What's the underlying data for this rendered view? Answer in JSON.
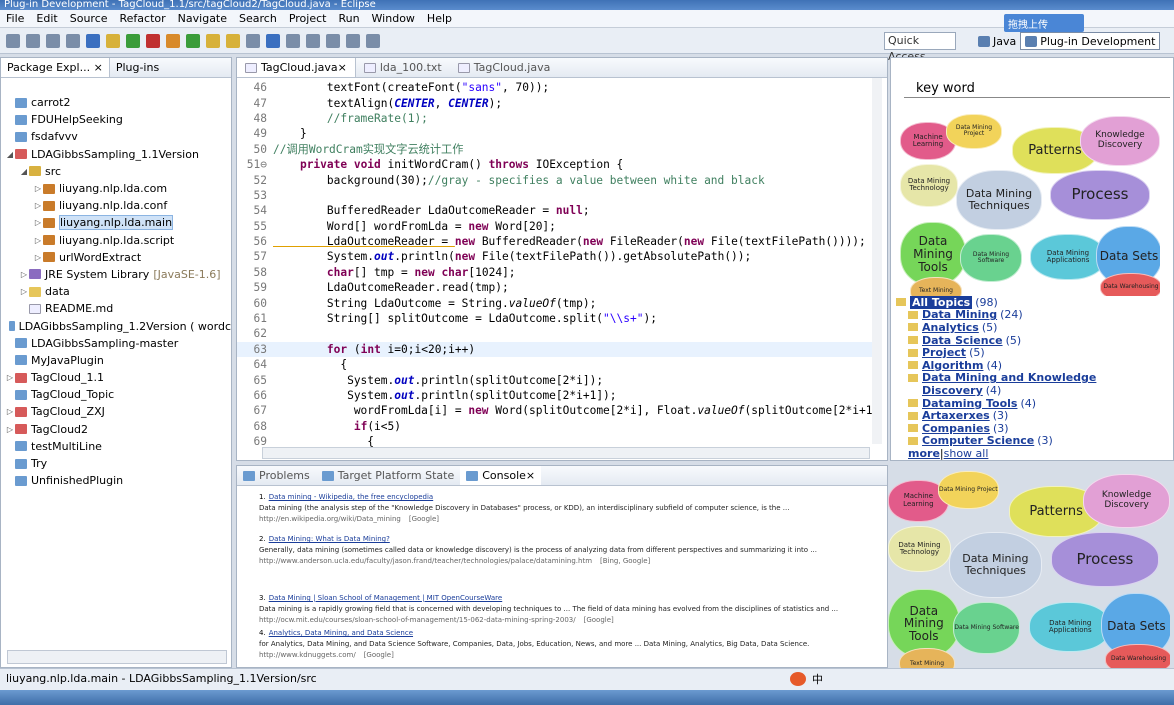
{
  "window": {
    "title": "Plug-in Development - TagCloud_1.1/src/tagCloud2/TagCloud.java - Eclipse"
  },
  "menu": [
    "File",
    "Edit",
    "Source",
    "Refactor",
    "Navigate",
    "Search",
    "Project",
    "Run",
    "Window",
    "Help"
  ],
  "toolbar": {
    "quick_access": "Quick Access",
    "upload_label": "拖拽上传"
  },
  "perspectives": [
    {
      "label": "Java"
    },
    {
      "label": "Plug-in Development"
    }
  ],
  "left_panel": {
    "tabs": [
      "Package Expl...",
      "Plug-ins"
    ],
    "tree": [
      {
        "label": "carrot2",
        "indent": 0,
        "icon": "i-proj",
        "arrow": ""
      },
      {
        "label": "FDUHelpSeeking",
        "indent": 0,
        "icon": "i-proj",
        "arrow": ""
      },
      {
        "label": "fsdafvvv",
        "indent": 0,
        "icon": "i-proj",
        "arrow": ""
      },
      {
        "label": "LDAGibbsSampling_1.1Version",
        "indent": 0,
        "icon": "i-plug",
        "arrow": "◢"
      },
      {
        "label": "src",
        "indent": 1,
        "icon": "i-src",
        "arrow": "◢"
      },
      {
        "label": "liuyang.nlp.lda.com",
        "indent": 2,
        "icon": "i-pkg",
        "arrow": "▷"
      },
      {
        "label": "liuyang.nlp.lda.conf",
        "indent": 2,
        "icon": "i-pkg",
        "arrow": "▷"
      },
      {
        "label": "liuyang.nlp.lda.main",
        "indent": 2,
        "icon": "i-pkg",
        "arrow": "▷",
        "selected": true
      },
      {
        "label": "liuyang.nlp.lda.script",
        "indent": 2,
        "icon": "i-pkg",
        "arrow": "▷"
      },
      {
        "label": "urlWordExtract",
        "indent": 2,
        "icon": "i-pkg",
        "arrow": "▷"
      },
      {
        "label": "JRE System Library",
        "extra": "[JavaSE-1.6]",
        "indent": 1,
        "icon": "i-jre",
        "arrow": "▷"
      },
      {
        "label": "data",
        "indent": 1,
        "icon": "i-fold",
        "arrow": "▷"
      },
      {
        "label": "README.md",
        "indent": 1,
        "icon": "i-file",
        "arrow": ""
      },
      {
        "label": "LDAGibbsSampling_1.2Version ( wordc",
        "indent": 0,
        "icon": "i-proj",
        "arrow": ""
      },
      {
        "label": "LDAGibbsSampling-master",
        "indent": 0,
        "icon": "i-proj",
        "arrow": ""
      },
      {
        "label": "MyJavaPlugin",
        "indent": 0,
        "icon": "i-proj",
        "arrow": ""
      },
      {
        "label": "TagCloud_1.1",
        "indent": 0,
        "icon": "i-plug",
        "arrow": "▷"
      },
      {
        "label": "TagCloud_Topic",
        "indent": 0,
        "icon": "i-proj",
        "arrow": ""
      },
      {
        "label": "TagCloud_ZXJ",
        "indent": 0,
        "icon": "i-plug",
        "arrow": "▷"
      },
      {
        "label": "TagCloud2",
        "indent": 0,
        "icon": "i-plug",
        "arrow": "▷"
      },
      {
        "label": "testMultiLine",
        "indent": 0,
        "icon": "i-proj",
        "arrow": ""
      },
      {
        "label": "Try",
        "indent": 0,
        "icon": "i-proj",
        "arrow": ""
      },
      {
        "label": "UnfinishedPlugin",
        "indent": 0,
        "icon": "i-proj",
        "arrow": ""
      }
    ]
  },
  "editor": {
    "tabs": [
      {
        "label": "TagCloud.java",
        "active": true
      },
      {
        "label": "lda_100.txt"
      },
      {
        "label": "TagCloud.java"
      }
    ],
    "lines": [
      {
        "n": "46",
        "segs": [
          [
            "        textFont(createFont(",
            ""
          ],
          [
            "\"sans\"",
            "str"
          ],
          [
            ", 70));",
            ""
          ]
        ]
      },
      {
        "n": "47",
        "segs": [
          [
            "        textAlign(",
            ""
          ],
          [
            "CENTER",
            "st"
          ],
          [
            ", ",
            ""
          ],
          [
            "CENTER",
            "st"
          ],
          [
            ");",
            ""
          ]
        ]
      },
      {
        "n": "48",
        "segs": [
          [
            "        //frameRate(1);",
            "cm"
          ]
        ]
      },
      {
        "n": "49",
        "segs": [
          [
            "    }",
            ""
          ]
        ]
      },
      {
        "n": "50",
        "segs": [
          [
            "//调用WordCram实现文字云统计工作",
            "cm"
          ]
        ]
      },
      {
        "n": "51⊖",
        "segs": [
          [
            "    ",
            ""
          ],
          [
            "private void",
            "kw"
          ],
          [
            " initWordCram() ",
            ""
          ],
          [
            "throws",
            "kw"
          ],
          [
            " IOException {",
            ""
          ]
        ]
      },
      {
        "n": "52",
        "segs": [
          [
            "        background(30);",
            ""
          ],
          [
            "//gray - specifies a value between white and black",
            "cm"
          ]
        ]
      },
      {
        "n": "53",
        "segs": [
          [
            "",
            ""
          ]
        ]
      },
      {
        "n": "54",
        "segs": [
          [
            "        BufferedReader LdaOutcomeReader = ",
            ""
          ],
          [
            "null",
            "kw"
          ],
          [
            ";",
            ""
          ]
        ]
      },
      {
        "n": "55",
        "segs": [
          [
            "        Word[] wordFromLda = ",
            ""
          ],
          [
            "new",
            "kw"
          ],
          [
            " Word[20];",
            ""
          ]
        ]
      },
      {
        "n": "56",
        "segs": [
          [
            "        LdaOutcomeReader = ",
            "un"
          ],
          [
            "new",
            "kw"
          ],
          [
            " BufferedReader(",
            ""
          ],
          [
            "new",
            "kw"
          ],
          [
            " FileReader(",
            ""
          ],
          [
            "new",
            "kw"
          ],
          [
            " File(textFilePath())));",
            ""
          ]
        ]
      },
      {
        "n": "57",
        "segs": [
          [
            "        System.",
            ""
          ],
          [
            "out",
            "st"
          ],
          [
            ".println(",
            ""
          ],
          [
            "new",
            "kw"
          ],
          [
            " File(textFilePath()).getAbsolutePath());",
            ""
          ]
        ]
      },
      {
        "n": "58",
        "segs": [
          [
            "        ",
            ""
          ],
          [
            "char",
            "kw"
          ],
          [
            "[] tmp = ",
            ""
          ],
          [
            "new",
            "kw"
          ],
          [
            " ",
            ""
          ],
          [
            "char",
            "kw"
          ],
          [
            "[1024];",
            ""
          ]
        ]
      },
      {
        "n": "59",
        "segs": [
          [
            "        LdaOutcomeReader.read(tmp);",
            ""
          ]
        ]
      },
      {
        "n": "60",
        "segs": [
          [
            "        String LdaOutcome = String.",
            ""
          ],
          [
            "valueOf",
            "it"
          ],
          [
            "(tmp);",
            ""
          ]
        ]
      },
      {
        "n": "61",
        "segs": [
          [
            "        String[] splitOutcome = LdaOutcome.split(",
            ""
          ],
          [
            "\"\\\\s+\"",
            "str"
          ],
          [
            ");",
            ""
          ]
        ]
      },
      {
        "n": "62",
        "segs": [
          [
            "",
            ""
          ]
        ]
      },
      {
        "n": "63",
        "segs": [
          [
            "        ",
            ""
          ],
          [
            "for",
            "kw"
          ],
          [
            " (",
            ""
          ],
          [
            "int",
            "kw"
          ],
          [
            " i=0;i<20;i++)",
            ""
          ]
        ],
        "hl": true
      },
      {
        "n": "64",
        "segs": [
          [
            "          {",
            ""
          ]
        ]
      },
      {
        "n": "65",
        "segs": [
          [
            "           System.",
            ""
          ],
          [
            "out",
            "st"
          ],
          [
            ".println(splitOutcome[2*i]);",
            ""
          ]
        ]
      },
      {
        "n": "66",
        "segs": [
          [
            "           System.",
            ""
          ],
          [
            "out",
            "st"
          ],
          [
            ".println(splitOutcome[2*i+1]);",
            ""
          ]
        ]
      },
      {
        "n": "67",
        "segs": [
          [
            "            wordFromLda[i] = ",
            ""
          ],
          [
            "new",
            "kw"
          ],
          [
            " Word(splitOutcome[2*i], Float.",
            ""
          ],
          [
            "valueOf",
            "it"
          ],
          [
            "(splitOutcome[2*i+1]",
            ""
          ]
        ]
      },
      {
        "n": "68",
        "segs": [
          [
            "            ",
            ""
          ],
          [
            "if",
            "kw"
          ],
          [
            "(i<5)",
            ""
          ]
        ]
      },
      {
        "n": "69",
        "segs": [
          [
            "              {",
            ""
          ]
        ]
      }
    ]
  },
  "right_panel": {
    "keyword_label": "key word",
    "topics_header": {
      "label": "All Topics",
      "count": "(98)"
    },
    "topics": [
      {
        "label": "Data Mining",
        "count": "(24)"
      },
      {
        "label": "Analytics",
        "count": "(5)"
      },
      {
        "label": "Data Science",
        "count": "(5)"
      },
      {
        "label": "Project",
        "count": "(5)"
      },
      {
        "label": "Algorithm",
        "count": "(4)"
      },
      {
        "label": "Data Mining and Knowledge",
        "count": ""
      },
      {
        "label": "Discovery",
        "count": "(4)",
        "indent": true
      },
      {
        "label": "Dataming Tools",
        "count": "(4)"
      },
      {
        "label": "Artaxerxes",
        "count": "(3)"
      },
      {
        "label": "Companies",
        "count": "(3)"
      },
      {
        "label": "Computer Science",
        "count": "(3)"
      }
    ],
    "more": {
      "more": "more",
      "sep": " | ",
      "show_all": "show all"
    }
  },
  "cloud": {
    "cells": [
      {
        "t": "Machine Learning",
        "c": "#e25b8a",
        "fs": 7
      },
      {
        "t": "Data Mining Project",
        "c": "#f2d35a",
        "fs": 6
      },
      {
        "t": "Patterns",
        "c": "#dfe05a",
        "fs": 13
      },
      {
        "t": "Knowledge Discovery",
        "c": "#e2a0d5",
        "fs": 9
      },
      {
        "t": "Data Mining Technology",
        "c": "#e6e6a8",
        "fs": 7
      },
      {
        "t": "Data Mining Techniques",
        "c": "#c2cfe1",
        "fs": 11
      },
      {
        "t": "Process",
        "c": "#a68fd9",
        "fs": 15
      },
      {
        "t": "Data Mining Tools",
        "c": "#76d659",
        "fs": 12
      },
      {
        "t": "Data Mining Software",
        "c": "#69d28f",
        "fs": 6
      },
      {
        "t": "Data Mining Applications",
        "c": "#5bc8d9",
        "fs": 7
      },
      {
        "t": "Data Sets",
        "c": "#5aa8e6",
        "fs": 12
      },
      {
        "t": "Text Mining",
        "c": "#e6b45a",
        "fs": 6
      },
      {
        "t": "Data Warehousing",
        "c": "#e65a5a",
        "fs": 6
      }
    ]
  },
  "console": {
    "tabs": [
      {
        "label": "Problems"
      },
      {
        "label": "Target Platform State"
      },
      {
        "label": "Console",
        "active": true
      }
    ],
    "results": [
      {
        "num": "1.",
        "title": "Data mining - Wikipedia, the free encyclopedia",
        "desc": "Data mining (the analysis step of the \"Knowledge Discovery in Databases\" process, or KDD), an interdisciplinary subfield of computer science, is the ...",
        "url": "http://en.wikipedia.org/wiki/Data_mining",
        "src": "[Google]"
      },
      {
        "num": "2.",
        "title": "Data Mining: What is Data Mining?",
        "desc": "Generally, data mining (sometimes called data or knowledge discovery) is the process of analyzing data from different perspectives and summarizing it into ...",
        "url": "http://www.anderson.ucla.edu/faculty/jason.frand/teacher/technologies/palace/datamining.htm",
        "src": "[Bing, Google]"
      },
      {
        "num": "3.",
        "title": "Data Mining | Sloan School of Management | MIT OpenCourseWare",
        "desc": "Data mining is a rapidly growing field that is concerned with developing techniques to ... The field of data mining has evolved from the disciplines of statistics and ...",
        "url": "http://ocw.mit.edu/courses/sloan-school-of-management/15-062-data-mining-spring-2003/",
        "src": "[Google]"
      },
      {
        "num": "4.",
        "title": "Analytics, Data Mining, and Data Science",
        "desc": "for Analytics, Data Mining, and Data Science Software, Companies, Data, Jobs, Education, News, and more ... Data Mining, Analytics, Big Data, Data Science.",
        "url": "http://www.kdnuggets.com/",
        "src": "[Google]"
      }
    ]
  },
  "status": {
    "text": "liuyang.nlp.lda.main - LDAGibbsSampling_1.1Version/src"
  },
  "ime": {
    "label": "中"
  }
}
